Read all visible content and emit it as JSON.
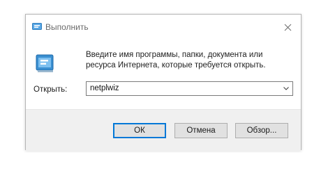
{
  "window": {
    "title": "Выполнить",
    "close_icon": "close-icon"
  },
  "description": "Введите имя программы, папки, документа или ресурса Интернета, которые требуется открыть.",
  "open_label": "Открыть:",
  "open_field": {
    "value": "netplwiz"
  },
  "buttons": {
    "ok": "ОК",
    "cancel": "Отмена",
    "browse": "Обзор..."
  },
  "colors": {
    "accent": "#0078d7",
    "icon_blue": "#3a8fd1",
    "footer_bg": "#f0f0f0"
  }
}
